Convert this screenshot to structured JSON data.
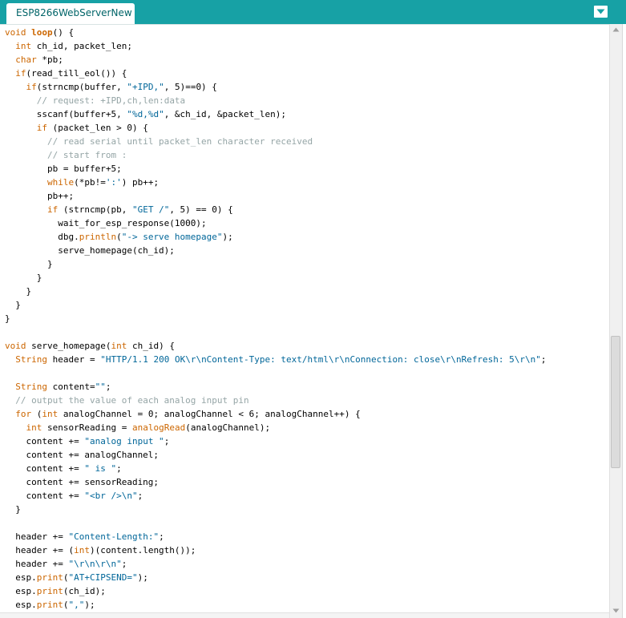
{
  "tabbar": {
    "tab_title": "ESP8266WebServerNew",
    "menu_icon": "triangle-down-icon",
    "colors": {
      "background": "#17a1a5",
      "tab_text": "#006468"
    }
  },
  "editor": {
    "colors": {
      "keyword": "#cc6600",
      "string": "#006699",
      "comment": "#95a5a6",
      "text": "#000000"
    },
    "lines": [
      [
        {
          "t": "void",
          "c": "kw"
        },
        {
          "t": " "
        },
        {
          "t": "loop",
          "c": "kb"
        },
        {
          "t": "() {"
        }
      ],
      [
        {
          "t": "  "
        },
        {
          "t": "int",
          "c": "kw"
        },
        {
          "t": " ch_id, packet_len;"
        }
      ],
      [
        {
          "t": "  "
        },
        {
          "t": "char",
          "c": "kw"
        },
        {
          "t": " *pb;"
        }
      ],
      [
        {
          "t": "  "
        },
        {
          "t": "if",
          "c": "kw"
        },
        {
          "t": "(read_till_eol()) {"
        }
      ],
      [
        {
          "t": "    "
        },
        {
          "t": "if",
          "c": "kw"
        },
        {
          "t": "(strncmp(buffer, "
        },
        {
          "t": "\"+IPD,\"",
          "c": "str"
        },
        {
          "t": ", 5)==0) {"
        }
      ],
      [
        {
          "t": "      "
        },
        {
          "t": "// request: +IPD,ch,len:data",
          "c": "cm"
        }
      ],
      [
        {
          "t": "      sscanf(buffer+5, "
        },
        {
          "t": "\"%d,%d\"",
          "c": "str"
        },
        {
          "t": ", &ch_id, &packet_len);"
        }
      ],
      [
        {
          "t": "      "
        },
        {
          "t": "if",
          "c": "kw"
        },
        {
          "t": " (packet_len > 0) {"
        }
      ],
      [
        {
          "t": "        "
        },
        {
          "t": "// read serial until packet_len character received",
          "c": "cm"
        }
      ],
      [
        {
          "t": "        "
        },
        {
          "t": "// start from :",
          "c": "cm"
        }
      ],
      [
        {
          "t": "        pb = buffer+5;"
        }
      ],
      [
        {
          "t": "        "
        },
        {
          "t": "while",
          "c": "kw"
        },
        {
          "t": "(*pb!="
        },
        {
          "t": "':'",
          "c": "str"
        },
        {
          "t": ") pb++;"
        }
      ],
      [
        {
          "t": "        pb++;"
        }
      ],
      [
        {
          "t": "        "
        },
        {
          "t": "if",
          "c": "kw"
        },
        {
          "t": " (strncmp(pb, "
        },
        {
          "t": "\"GET /\"",
          "c": "str"
        },
        {
          "t": ", 5) == 0) {"
        }
      ],
      [
        {
          "t": "          wait_for_esp_response(1000);"
        }
      ],
      [
        {
          "t": "          dbg."
        },
        {
          "t": "println",
          "c": "kw"
        },
        {
          "t": "("
        },
        {
          "t": "\"-> serve homepage\"",
          "c": "str"
        },
        {
          "t": ");"
        }
      ],
      [
        {
          "t": "          serve_homepage(ch_id);"
        }
      ],
      [
        {
          "t": "        }"
        }
      ],
      [
        {
          "t": "      }"
        }
      ],
      [
        {
          "t": "    }"
        }
      ],
      [
        {
          "t": "  }"
        }
      ],
      [
        {
          "t": "}"
        }
      ],
      [],
      [
        {
          "t": "void",
          "c": "kw"
        },
        {
          "t": " serve_homepage("
        },
        {
          "t": "int",
          "c": "kw"
        },
        {
          "t": " ch_id) {"
        }
      ],
      [
        {
          "t": "  "
        },
        {
          "t": "String",
          "c": "kw"
        },
        {
          "t": " header = "
        },
        {
          "t": "\"HTTP/1.1 200 OK\\r\\nContent-Type: text/html\\r\\nConnection: close\\r\\nRefresh: 5\\r\\n\"",
          "c": "str"
        },
        {
          "t": ";"
        }
      ],
      [],
      [
        {
          "t": "  "
        },
        {
          "t": "String",
          "c": "kw"
        },
        {
          "t": " content="
        },
        {
          "t": "\"\"",
          "c": "str"
        },
        {
          "t": ";"
        }
      ],
      [
        {
          "t": "  "
        },
        {
          "t": "// output the value of each analog input pin",
          "c": "cm"
        }
      ],
      [
        {
          "t": "  "
        },
        {
          "t": "for",
          "c": "kw"
        },
        {
          "t": " ("
        },
        {
          "t": "int",
          "c": "kw"
        },
        {
          "t": " analogChannel = 0; analogChannel < 6; analogChannel++) {"
        }
      ],
      [
        {
          "t": "    "
        },
        {
          "t": "int",
          "c": "kw"
        },
        {
          "t": " sensorReading = "
        },
        {
          "t": "analogRead",
          "c": "kw"
        },
        {
          "t": "(analogChannel);"
        }
      ],
      [
        {
          "t": "    content += "
        },
        {
          "t": "\"analog input \"",
          "c": "str"
        },
        {
          "t": ";"
        }
      ],
      [
        {
          "t": "    content += analogChannel;"
        }
      ],
      [
        {
          "t": "    content += "
        },
        {
          "t": "\" is \"",
          "c": "str"
        },
        {
          "t": ";"
        }
      ],
      [
        {
          "t": "    content += sensorReading;"
        }
      ],
      [
        {
          "t": "    content += "
        },
        {
          "t": "\"<br />\\n\"",
          "c": "str"
        },
        {
          "t": ";"
        }
      ],
      [
        {
          "t": "  }"
        }
      ],
      [],
      [
        {
          "t": "  header += "
        },
        {
          "t": "\"Content-Length:\"",
          "c": "str"
        },
        {
          "t": ";"
        }
      ],
      [
        {
          "t": "  header += ("
        },
        {
          "t": "int",
          "c": "kw"
        },
        {
          "t": ")(content.length());"
        }
      ],
      [
        {
          "t": "  header += "
        },
        {
          "t": "\"\\r\\n\\r\\n\"",
          "c": "str"
        },
        {
          "t": ";"
        }
      ],
      [
        {
          "t": "  esp."
        },
        {
          "t": "print",
          "c": "kw"
        },
        {
          "t": "("
        },
        {
          "t": "\"AT+CIPSEND=\"",
          "c": "str"
        },
        {
          "t": ");"
        }
      ],
      [
        {
          "t": "  esp."
        },
        {
          "t": "print",
          "c": "kw"
        },
        {
          "t": "(ch_id);"
        }
      ],
      [
        {
          "t": "  esp."
        },
        {
          "t": "print",
          "c": "kw"
        },
        {
          "t": "("
        },
        {
          "t": "\",\"",
          "c": "str"
        },
        {
          "t": ");"
        }
      ]
    ]
  },
  "scrollbar": {
    "up_icon": "arrow-up-icon",
    "down_icon": "arrow-down-icon"
  }
}
